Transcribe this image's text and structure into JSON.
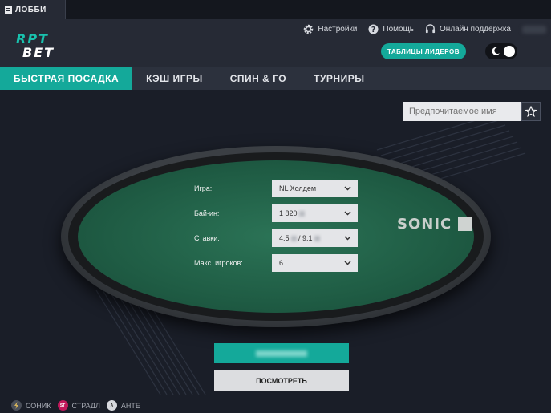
{
  "tabbar": {
    "lobby_label": "ЛОББИ"
  },
  "header": {
    "logo_line1": "RPT",
    "logo_line2": "BET",
    "links": {
      "settings": "Настройки",
      "help": "Помощь",
      "support": "Онлайн поддержка"
    },
    "leaders_button": "ТАБЛИЦЫ ЛИДЕРОВ"
  },
  "nav": {
    "tabs": [
      "БЫСТРАЯ ПОСАДКА",
      "КЭШ ИГРЫ",
      "СПИН & ГО",
      "ТУРНИРЫ"
    ]
  },
  "main": {
    "preferred_name_placeholder": "Предпочитаемое имя",
    "form": {
      "game_label": "Игра:",
      "game_value": "NL Холдем",
      "buyin_label": "Бай-ин:",
      "buyin_value": "1 820",
      "stakes_label": "Ставки:",
      "stakes_value_a": "4.5",
      "stakes_sep": " / ",
      "stakes_value_b": "9.1",
      "players_label": "Макс. игроков:",
      "players_value": "6"
    },
    "table_brand": "SONIC",
    "watch_button": "ПОСМОТРЕТЬ",
    "legend": [
      {
        "label": "СОНИК",
        "icon_text": "",
        "color": "#4a4f5a"
      },
      {
        "label": "СТРАДЛ",
        "icon_text": "ST",
        "color": "#c2185b"
      },
      {
        "label": "АНТЕ",
        "icon_text": "A",
        "color": "#4a4f5a"
      }
    ]
  },
  "colors": {
    "accent": "#14a99a",
    "background": "#1b1f29",
    "felt": "#1f5c44"
  }
}
